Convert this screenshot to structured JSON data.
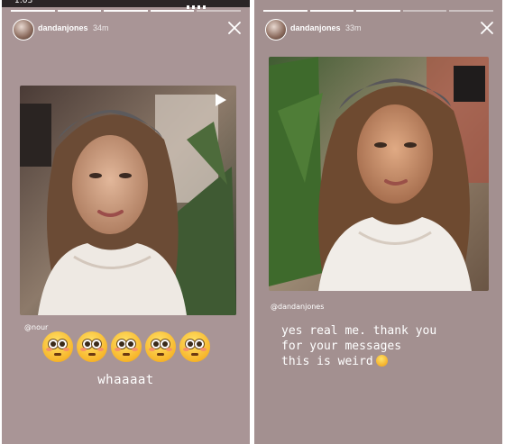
{
  "left_story": {
    "username": "dandanjones",
    "time": "34m",
    "mention": "@nour",
    "emoji_name": "flushed-face",
    "emoji_count": 5,
    "caption": "whaaaat"
  },
  "right_story": {
    "username": "dandanjones",
    "time": "33m",
    "mention": "@dandanjones",
    "caption_lines": [
      "yes real me. thank you",
      "for your messages",
      "this is weird"
    ],
    "trailing_emoji_name": "smirking-face"
  },
  "colors": {
    "left_background": "#a99596",
    "right_background": "#a39090",
    "text": "#ffffff"
  }
}
